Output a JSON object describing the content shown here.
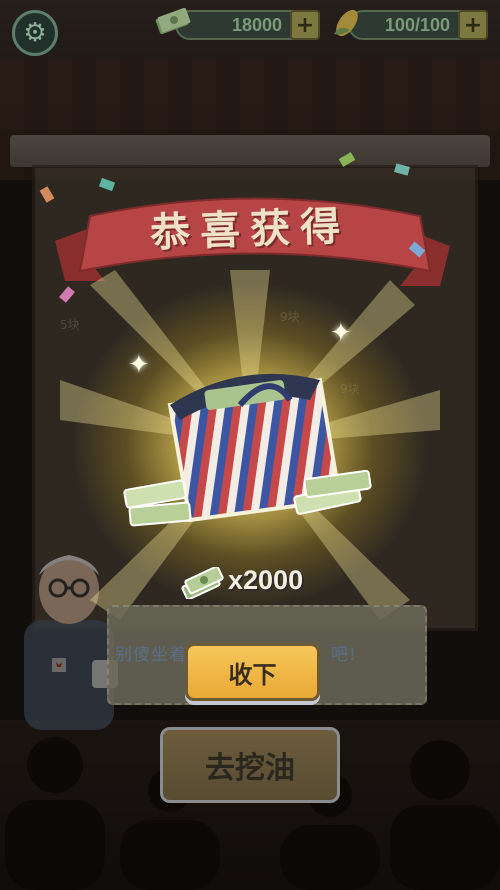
{
  "topbar": {
    "cash_value": "18000",
    "energy_value": "100/100",
    "add_symbol": "+"
  },
  "popup": {
    "title": "恭喜获得",
    "reward_amount": "x2000",
    "reward_icon": "cash-stack-icon",
    "item_icon": "money-bag-icon"
  },
  "dialog": {
    "text": "别傻坐着了，快去挖【油】吧!",
    "collect_label": "收下"
  },
  "main": {
    "dig_label": "去挖油"
  },
  "background": {
    "tile_labels": [
      "5块",
      "9块",
      "9块"
    ]
  },
  "colors": {
    "ribbon": "#b84545",
    "collect_button": "#f0b745",
    "glow": "#fff3b0"
  }
}
